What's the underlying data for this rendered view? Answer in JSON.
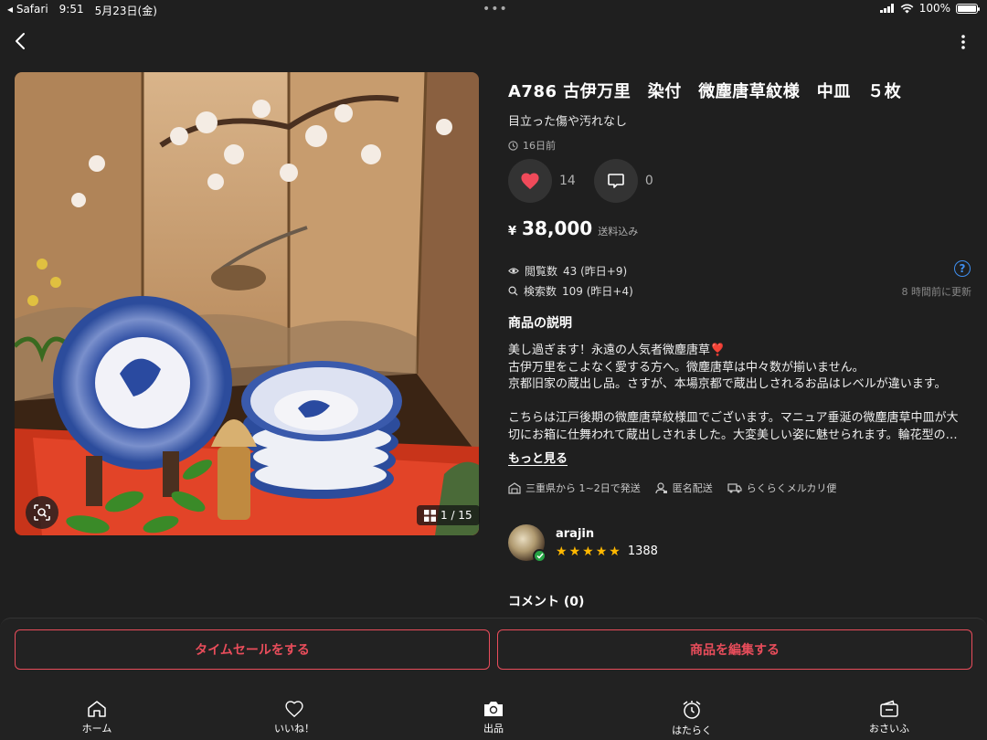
{
  "status_bar": {
    "app": "◂ Safari",
    "time": "9:51",
    "date": "5月23日(金)",
    "battery": "100%",
    "battery_level": 1.0
  },
  "product": {
    "title": "A786 古伊万里　染付　微塵唐草紋様　中皿　５枚",
    "subtitle": "目立った傷や汚れなし",
    "posted": "16日前",
    "likes": "14",
    "comments_count": "0",
    "price_symbol": "¥",
    "price": "38,000",
    "price_note": "送料込み"
  },
  "photo": {
    "counter": "1 / 15"
  },
  "stats": {
    "views_label": "閲覧数",
    "views_value": "43 (昨日+9)",
    "search_label": "検索数",
    "search_value": "109 (昨日+4)",
    "help": "?",
    "updated": "8 時間前に更新"
  },
  "description": {
    "heading": "商品の説明",
    "lines": [
      "美し過ぎます！永遠の人気者微塵唐草❣️",
      "古伊万里をこよなく愛する方へ。微塵唐草は中々数が揃いません。",
      "京都旧家の蔵出し品。さすが、本場京都で蔵出しされるお品はレベルが違います。",
      "",
      "こちらは江戸後期の微塵唐草紋様皿でございます。マニュア垂涎の微塵唐草中皿が大",
      "切にお箱に仕舞われて蔵出しされました。大変美しい姿に魅せられます。輪花型の…"
    ],
    "more": "もっと見る"
  },
  "shipping": {
    "from": "三重県から 1~2日で発送",
    "anonymous": "匿名配送",
    "method": "らくらくメルカリ便"
  },
  "seller": {
    "name": "arajin",
    "rating_stars": 5,
    "reviews": "1388"
  },
  "comments": {
    "heading": "コメント (0)"
  },
  "buttons": {
    "time_sale": "タイムセールをする",
    "edit": "商品を編集する"
  },
  "tabs": [
    {
      "label": "ホーム",
      "icon": "home-icon"
    },
    {
      "label": "いいね！",
      "icon": "heart-icon"
    },
    {
      "label": "出品",
      "icon": "camera-icon"
    },
    {
      "label": "はたらく",
      "icon": "alarm-icon"
    },
    {
      "label": "おさいふ",
      "icon": "wallet-icon"
    }
  ],
  "colors": {
    "background": "#1f1f1f",
    "accent_red": "#e94d5b",
    "heart": "#f04a5a",
    "link_blue": "#3f8ff0",
    "star": "#ffb800",
    "verified_green": "#27a445"
  }
}
